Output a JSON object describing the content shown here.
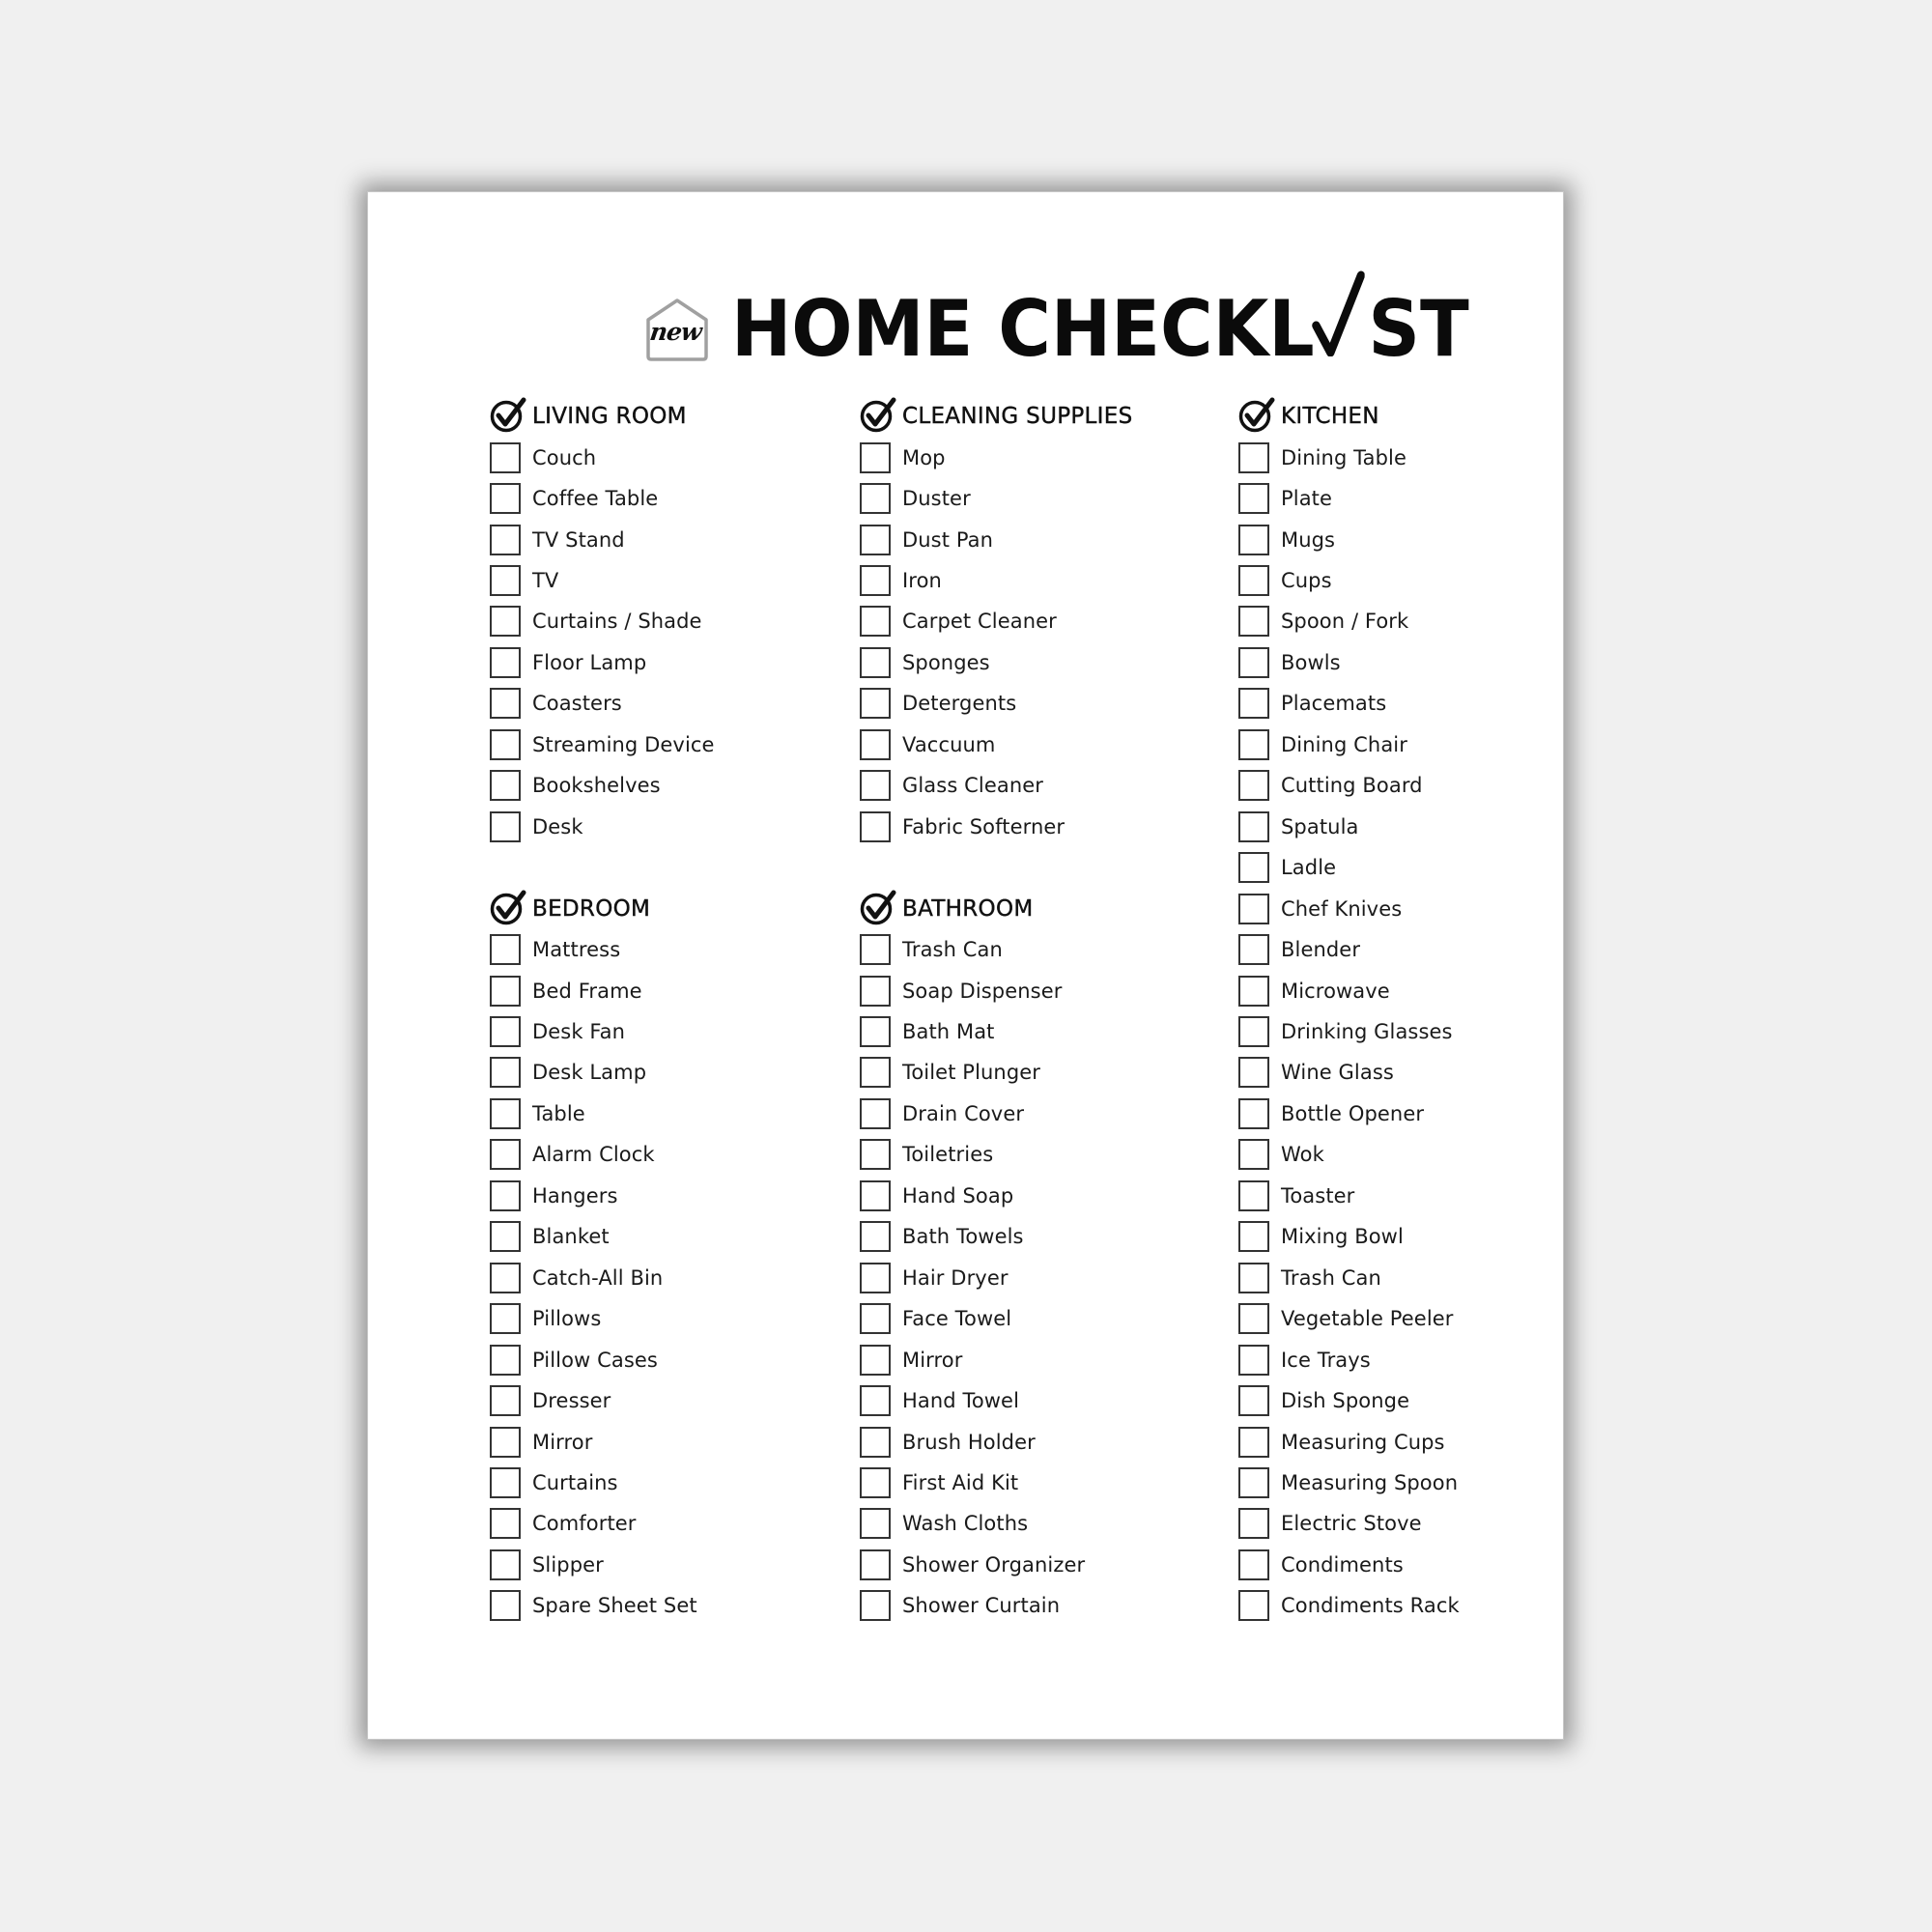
{
  "document": {
    "logo_word": "new",
    "title_part1": "HOME CHECKL",
    "title_part2": "ST",
    "colors": {
      "background": "#f0f0f0",
      "page": "#ffffff",
      "text": "#111111",
      "logo_outline": "#a0a0a0"
    }
  },
  "columns": [
    {
      "sections": [
        {
          "title": "LIVING ROOM",
          "items": [
            "Couch",
            "Coffee Table",
            "TV Stand",
            "TV",
            "Curtains / Shade",
            "Floor Lamp",
            "Coasters",
            "Streaming Device",
            "Bookshelves",
            "Desk"
          ]
        },
        {
          "title": "BEDROOM",
          "items": [
            "Mattress",
            "Bed Frame",
            "Desk Fan",
            "Desk Lamp",
            "Table",
            "Alarm Clock",
            "Hangers",
            "Blanket",
            "Catch-All Bin",
            "Pillows",
            "Pillow Cases",
            "Dresser",
            "Mirror",
            "Curtains",
            "Comforter",
            "Slipper",
            "Spare Sheet Set"
          ]
        }
      ]
    },
    {
      "sections": [
        {
          "title": "CLEANING SUPPLIES",
          "items": [
            "Mop",
            "Duster",
            "Dust Pan",
            "Iron",
            "Carpet Cleaner",
            "Sponges",
            "Detergents",
            "Vaccuum",
            "Glass Cleaner",
            "Fabric Softerner"
          ]
        },
        {
          "title": "BATHROOM",
          "items": [
            "Trash Can",
            "Soap Dispenser",
            "Bath Mat",
            "Toilet Plunger",
            "Drain Cover",
            "Toiletries",
            "Hand Soap",
            "Bath Towels",
            "Hair Dryer",
            "Face Towel",
            "Mirror",
            "Hand Towel",
            "Brush Holder",
            "First Aid Kit",
            "Wash Cloths",
            "Shower Organizer",
            "Shower Curtain"
          ]
        }
      ]
    },
    {
      "sections": [
        {
          "title": "KITCHEN",
          "items": [
            "Dining Table",
            "Plate",
            "Mugs",
            "Cups",
            "Spoon / Fork",
            "Bowls",
            "Placemats",
            "Dining Chair",
            "Cutting Board",
            "Spatula",
            "Ladle",
            "Chef Knives",
            "Blender",
            "Microwave",
            "Drinking Glasses",
            "Wine Glass",
            "Bottle Opener",
            "Wok",
            "Toaster",
            "Mixing Bowl",
            "Trash Can",
            "Vegetable Peeler",
            "Ice Trays",
            "Dish Sponge",
            "Measuring Cups",
            "Measuring Spoon",
            "Electric Stove",
            "Condiments",
            "Condiments Rack"
          ]
        }
      ]
    }
  ]
}
